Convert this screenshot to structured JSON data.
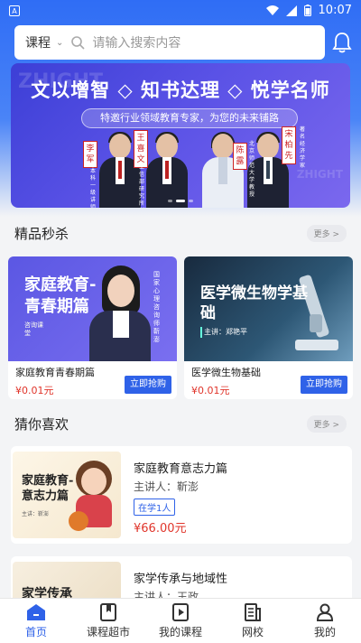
{
  "status_bar": {
    "time": "10:07",
    "badge": "A"
  },
  "search": {
    "category": "课程",
    "placeholder": "请输入搜索内容"
  },
  "banner": {
    "headline": "文以增智 ◇ 知书达理 ◇ 悦学名师",
    "subline": "特邀行业领域教育专家，为您的未来铺路",
    "watermark": "ZHIGHT",
    "names": [
      "李军",
      "王喜文",
      "陈露",
      "宋柏先"
    ],
    "titles": [
      "本科一级讲师",
      "工信部研究所所长",
      "北京师范大学教授",
      "著名经济学家"
    ]
  },
  "flash_sale": {
    "title": "精品秒杀",
    "more": "更多 >",
    "items": [
      {
        "thumb_title": "家庭教育-青春期篇",
        "thumb_side": "咨询课堂",
        "thumb_vertical": "国家心理咨询师 靳澎",
        "name": "家庭教育青春期篇",
        "price": "¥0.01元",
        "buy": "立即抢购"
      },
      {
        "thumb_title": "医学微生物学基础",
        "thumb_lecturer": "主讲：郑艳平",
        "name": "医学微生物基础",
        "price": "¥0.01元",
        "buy": "立即抢购"
      }
    ]
  },
  "guess": {
    "title": "猜你喜欢",
    "more": "更多 >",
    "items": [
      {
        "thumb_title": "家庭教育-意志力篇",
        "thumb_sub": "主讲：靳澎",
        "name": "家庭教育意志力篇",
        "lecturer": "主讲人：靳澎",
        "learning": "在学1人",
        "price": "¥66.00元"
      },
      {
        "thumb_title": "家学传承",
        "name": "家学传承与地域性",
        "lecturer": "主讲人：王政"
      }
    ]
  },
  "tabs": [
    {
      "label": "首页",
      "icon": "home-icon",
      "active": true
    },
    {
      "label": "课程超市",
      "icon": "bookmark-book-icon",
      "active": false
    },
    {
      "label": "我的课程",
      "icon": "play-book-icon",
      "active": false
    },
    {
      "label": "网校",
      "icon": "document-icon",
      "active": false
    },
    {
      "label": "我的",
      "icon": "user-icon",
      "active": false
    }
  ],
  "colors": {
    "accent": "#2f62e8",
    "price": "#e0352b",
    "header": "#2f6df5"
  }
}
